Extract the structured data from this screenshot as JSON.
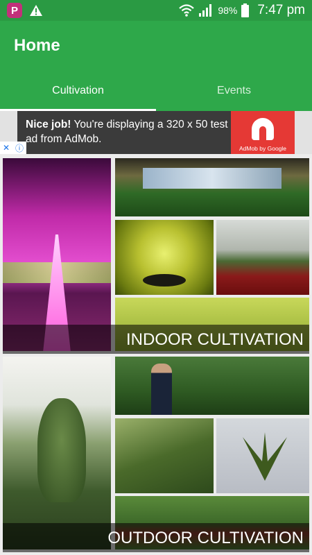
{
  "status_bar": {
    "battery": "98%",
    "time": "7:47 pm"
  },
  "app_bar": {
    "title": "Home"
  },
  "tabs": [
    {
      "label": "Cultivation"
    },
    {
      "label": "Events"
    }
  ],
  "ad": {
    "headline": "Nice job!",
    "body": " You're displaying a 320 x 50 test ad from AdMob.",
    "brand": "AdMob by Google",
    "choices_x": "✕",
    "choices_i": "ⓘ"
  },
  "categories": [
    {
      "label": "INDOOR CULTIVATION"
    },
    {
      "label": "OUTDOOR CULTIVATION"
    }
  ],
  "colors": {
    "primary": "#2ea84a",
    "status": "#2a9a43",
    "ad_red": "#e53935"
  }
}
